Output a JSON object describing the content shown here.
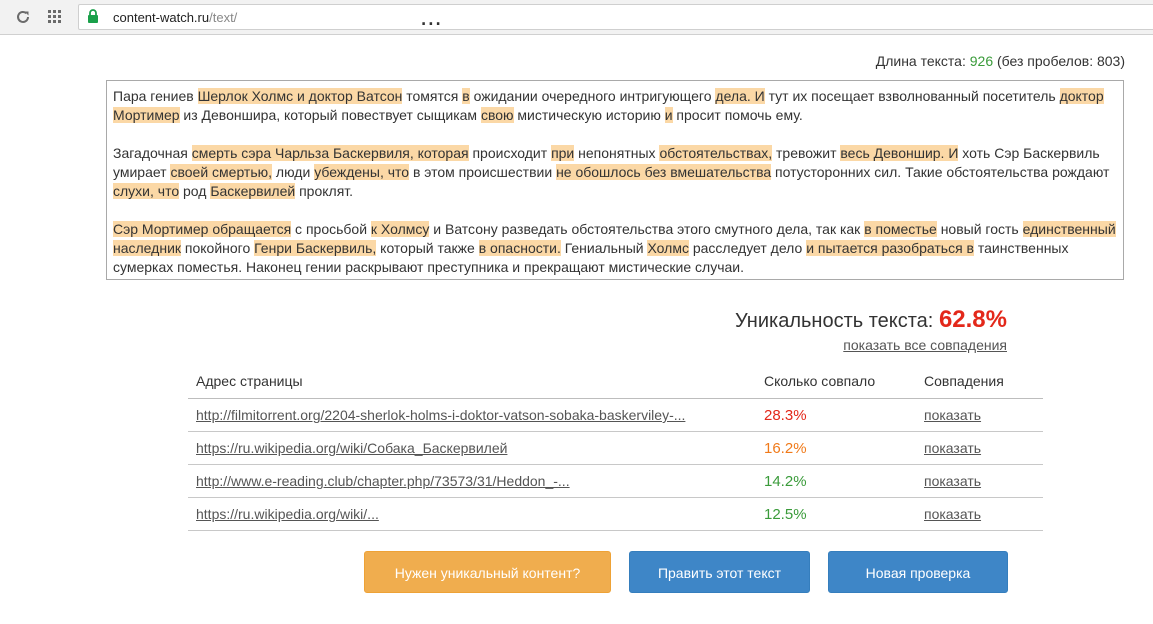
{
  "browser": {
    "url_host": "content-watch.ru",
    "url_path": "/text/"
  },
  "heading_fragment": "...",
  "text_length": {
    "label": "Длина текста:",
    "value": "926",
    "no_spaces": "(без пробелов: 803)"
  },
  "text_paragraphs": [
    [
      {
        "t": "Пара гениев ",
        "h": false
      },
      {
        "t": "Шерлок Холмс и доктор Ватсон",
        "h": true
      },
      {
        "t": " томятся ",
        "h": false
      },
      {
        "t": "в",
        "h": true
      },
      {
        "t": " ожидании очередного интригующего ",
        "h": false
      },
      {
        "t": "дела. И",
        "h": true
      },
      {
        "t": " тут их посещает взволнованный посетитель ",
        "h": false
      },
      {
        "t": "доктор Мортимер",
        "h": true
      },
      {
        "t": " из Девоншира, который повествует сыщикам ",
        "h": false
      },
      {
        "t": "свою",
        "h": true
      },
      {
        "t": " мистическую историю ",
        "h": false
      },
      {
        "t": "и",
        "h": true
      },
      {
        "t": " просит помочь ему.",
        "h": false
      }
    ],
    [
      {
        "t": "Загадочная ",
        "h": false
      },
      {
        "t": "смерть сэра Чарльза Баскервиля, которая",
        "h": true
      },
      {
        "t": " происходит ",
        "h": false
      },
      {
        "t": "при",
        "h": true
      },
      {
        "t": " непонятных ",
        "h": false
      },
      {
        "t": "обстоятельствах,",
        "h": true
      },
      {
        "t": " тревожит ",
        "h": false
      },
      {
        "t": "весь Девоншир. И",
        "h": true
      },
      {
        "t": " хоть Сэр Баскервиль умирает ",
        "h": false
      },
      {
        "t": "своей смертью,",
        "h": true
      },
      {
        "t": " люди ",
        "h": false
      },
      {
        "t": "убеждены, что",
        "h": true
      },
      {
        "t": " в этом происшествии ",
        "h": false
      },
      {
        "t": "не обошлось без вмешательства",
        "h": true
      },
      {
        "t": " потусторонних сил. Такие обстоятельства рождают ",
        "h": false
      },
      {
        "t": "слухи, что",
        "h": true
      },
      {
        "t": " род ",
        "h": false
      },
      {
        "t": "Баскервилей",
        "h": true
      },
      {
        "t": " проклят.",
        "h": false
      }
    ],
    [
      {
        "t": "Сэр Мортимер обращается",
        "h": true
      },
      {
        "t": " с просьбой ",
        "h": false
      },
      {
        "t": "к Холмсу",
        "h": true
      },
      {
        "t": " и Ватсону разведать обстоятельства этого смутного дела, так как ",
        "h": false
      },
      {
        "t": "в поместье",
        "h": true
      },
      {
        "t": " новый гость ",
        "h": false
      },
      {
        "t": "единственный наследник",
        "h": true
      },
      {
        "t": " покойного ",
        "h": false
      },
      {
        "t": "Генри Баскервиль,",
        "h": true
      },
      {
        "t": " который также ",
        "h": false
      },
      {
        "t": "в опасности.",
        "h": true
      },
      {
        "t": " Гениальный ",
        "h": false
      },
      {
        "t": "Холмс",
        "h": true
      },
      {
        "t": " расследует дело ",
        "h": false
      },
      {
        "t": "и пытается разобраться в",
        "h": true
      },
      {
        "t": " таинственных сумерках поместья. Наконец гении раскрывают преступника и прекращают мистические случаи.",
        "h": false
      }
    ]
  ],
  "uniqueness": {
    "label": "Уникальность текста:",
    "value": "62.8%",
    "show_all": "показать все совпадения"
  },
  "results": {
    "headers": [
      "Адрес страницы",
      "Сколько совпало",
      "Совпадения"
    ],
    "rows": [
      {
        "url": "http://filmitorrent.org/2204-sherlok-holms-i-doktor-vatson-sobaka-baskerviley-...",
        "pct": "28.3%",
        "pct_class": "pct-red",
        "action": "показать"
      },
      {
        "url": "https://ru.wikipedia.org/wiki/Собака_Баскервилей",
        "pct": "16.2%",
        "pct_class": "pct-orange",
        "action": "показать"
      },
      {
        "url": "http://www.e-reading.club/chapter.php/73573/31/Heddon_-...",
        "pct": "14.2%",
        "pct_class": "pct-green",
        "action": "показать"
      },
      {
        "url": "https://ru.wikipedia.org/wiki/...",
        "pct": "12.5%",
        "pct_class": "pct-green",
        "action": "показать"
      }
    ]
  },
  "buttons": {
    "unique_content": "Нужен уникальный контент?",
    "edit_text": "Править этот текст",
    "new_check": "Новая проверка"
  },
  "colors": {
    "highlight": "#fbd8a6",
    "uniq_red": "#e3281a",
    "orange_button": "#f0ad4e",
    "blue_button": "#3e86c7",
    "green": "#3a9b3a"
  },
  "icons": [
    "reload-icon",
    "apps-icon",
    "lock-icon"
  ]
}
